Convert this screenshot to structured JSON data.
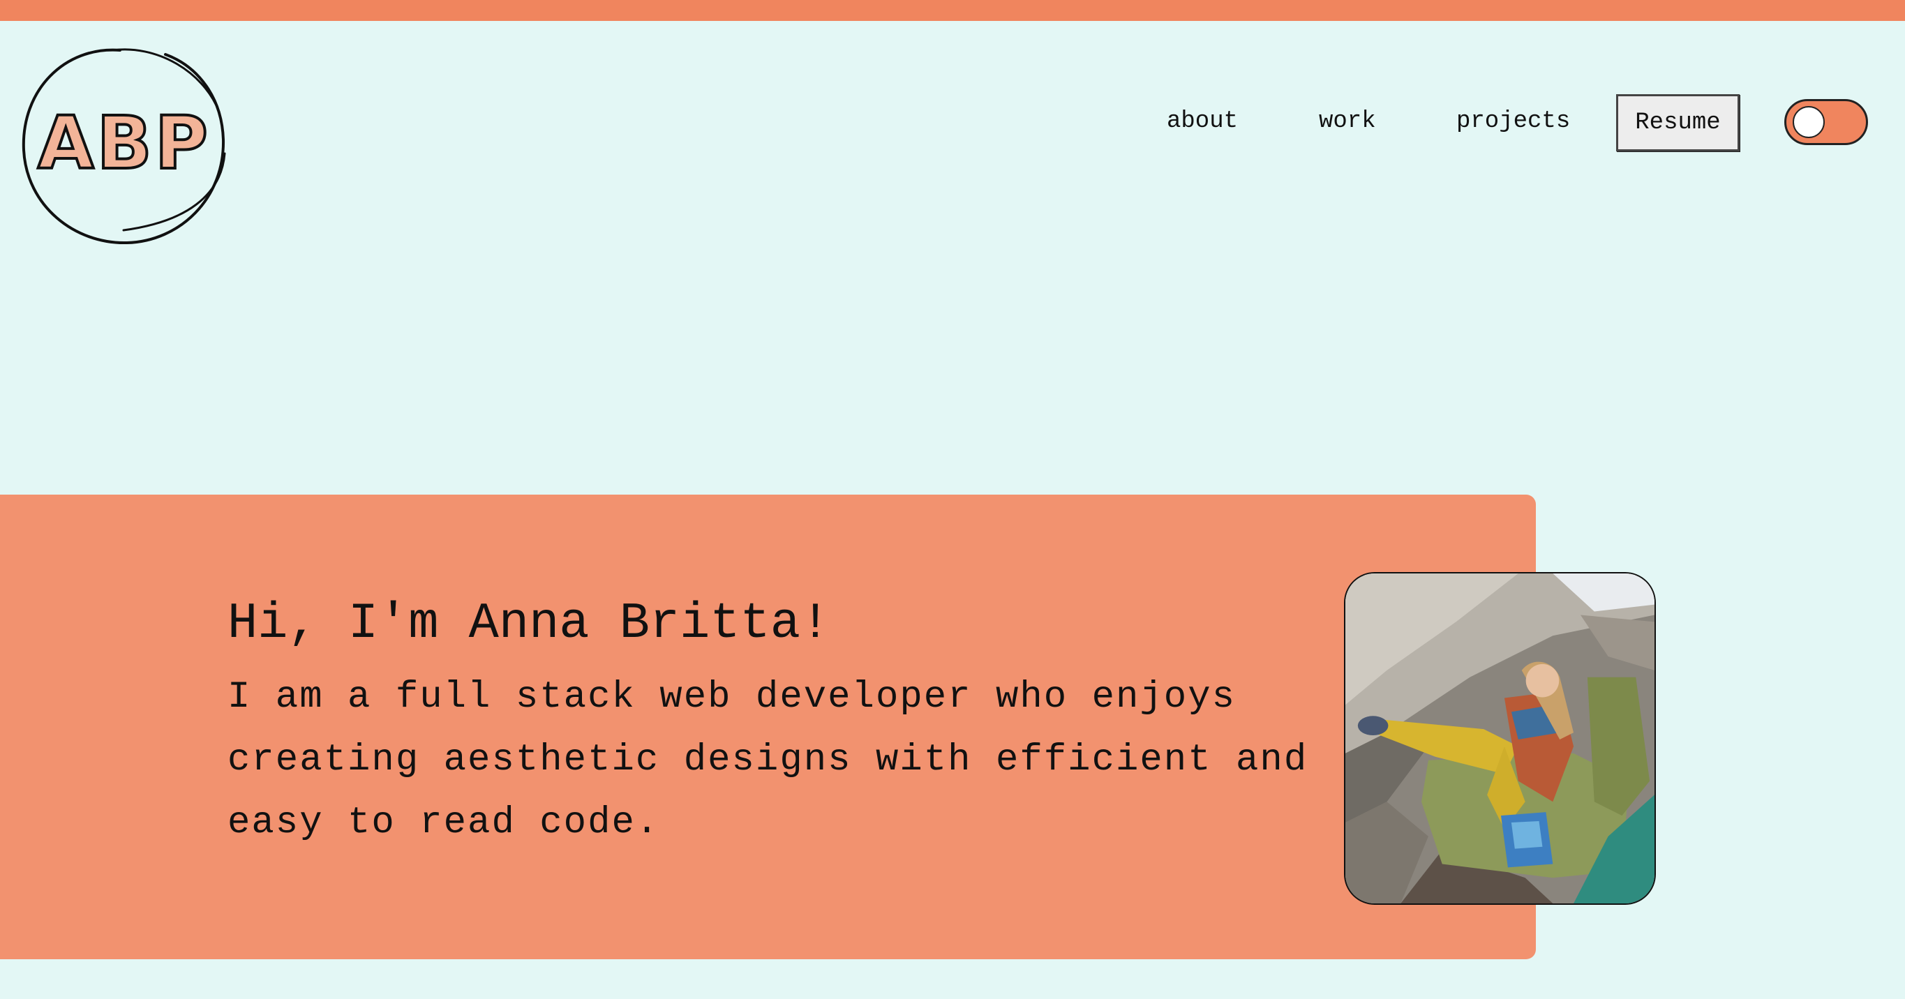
{
  "logo": {
    "text": "ABP",
    "fill_color": "#f3b498"
  },
  "nav": {
    "items": [
      {
        "label": "about"
      },
      {
        "label": "work"
      },
      {
        "label": "projects"
      }
    ],
    "resume_label": "Resume"
  },
  "theme_toggle": {
    "state": "off"
  },
  "hero": {
    "title": "Hi, I'm Anna Britta!",
    "description": "I am a full stack web developer who enjoys creating aesthetic designs with efficient and easy to read code."
  },
  "colors": {
    "background": "#e3f7f5",
    "accent": "#f0855e",
    "hero_panel": "#f2926f",
    "text": "#111111"
  }
}
